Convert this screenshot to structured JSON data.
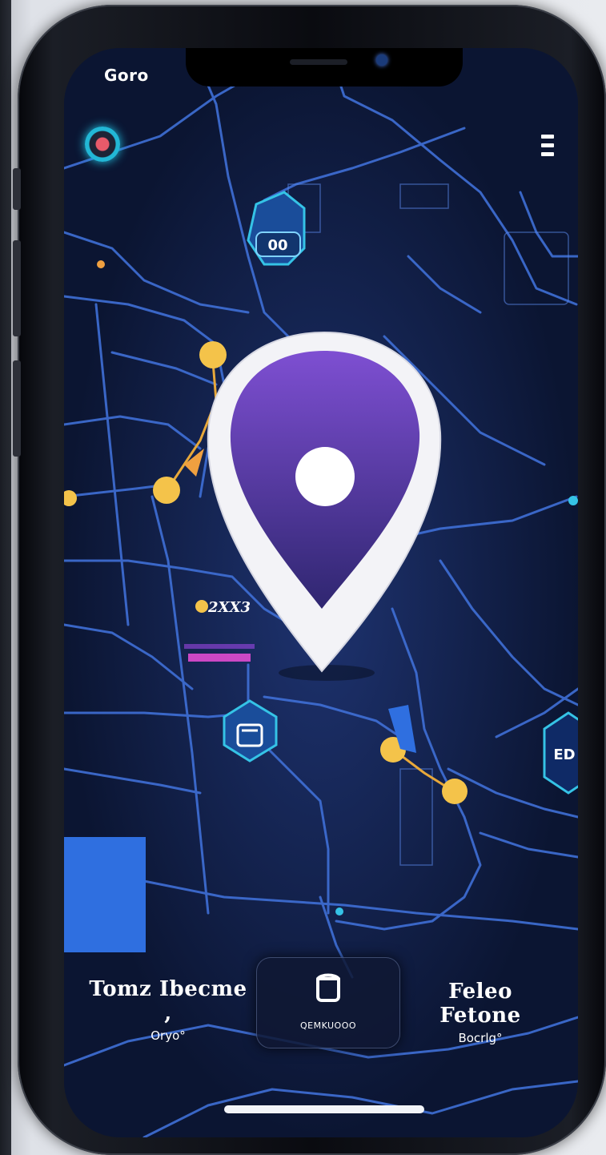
{
  "status_bar": {
    "time": "Goro"
  },
  "map_labels": {
    "marker_top": "00",
    "distance": "2XX3",
    "side_badge": "ED"
  },
  "bottom_bar": {
    "left_title": "Tomz Ibecme ,",
    "left_sub": "Oryo°",
    "center_label": "QEMKUOOO",
    "right_title": "Feleo Fetone",
    "right_sub": "Bocrlg°"
  },
  "icons": {
    "avatar": "profile-avatar",
    "menu": "menu-icon",
    "pin": "location-pin-icon",
    "card": "home-icon"
  },
  "colors": {
    "map_bg": "#0b1532",
    "roads": "#3f6fd6",
    "pin_gradient_top": "#7b4dcf",
    "pin_gradient_bottom": "#3a2b7e",
    "waypoint": "#f4c34a",
    "accent_block": "#2f6fe0"
  }
}
